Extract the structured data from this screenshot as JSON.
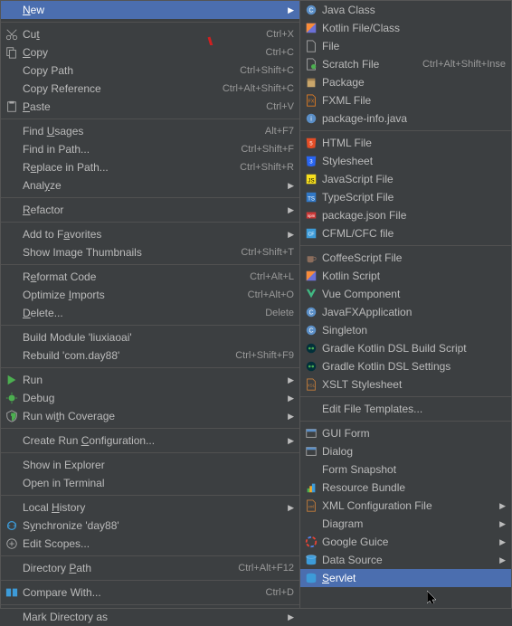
{
  "left": [
    {
      "type": "item",
      "icon": "",
      "label": "New",
      "shortcut": "",
      "arrow": true,
      "selected": true,
      "u": 0
    },
    {
      "type": "sep"
    },
    {
      "type": "item",
      "icon": "cut",
      "label": "Cut",
      "shortcut": "Ctrl+X",
      "u": 2
    },
    {
      "type": "item",
      "icon": "copy",
      "label": "Copy",
      "shortcut": "Ctrl+C",
      "u": 0
    },
    {
      "type": "item",
      "icon": "",
      "label": "Copy Path",
      "shortcut": "Ctrl+Shift+C"
    },
    {
      "type": "item",
      "icon": "",
      "label": "Copy Reference",
      "shortcut": "Ctrl+Alt+Shift+C"
    },
    {
      "type": "item",
      "icon": "paste",
      "label": "Paste",
      "shortcut": "Ctrl+V",
      "u": 0
    },
    {
      "type": "sep"
    },
    {
      "type": "item",
      "icon": "",
      "label": "Find Usages",
      "shortcut": "Alt+F7",
      "u": 5
    },
    {
      "type": "item",
      "icon": "",
      "label": "Find in Path...",
      "shortcut": "Ctrl+Shift+F"
    },
    {
      "type": "item",
      "icon": "",
      "label": "Replace in Path...",
      "shortcut": "Ctrl+Shift+R",
      "u": 1
    },
    {
      "type": "item",
      "icon": "",
      "label": "Analyze",
      "arrow": true,
      "u": 4
    },
    {
      "type": "sep"
    },
    {
      "type": "item",
      "icon": "",
      "label": "Refactor",
      "arrow": true,
      "u": 0
    },
    {
      "type": "sep"
    },
    {
      "type": "item",
      "icon": "",
      "label": "Add to Favorites",
      "arrow": true,
      "u": 8
    },
    {
      "type": "item",
      "icon": "",
      "label": "Show Image Thumbnails",
      "shortcut": "Ctrl+Shift+T"
    },
    {
      "type": "sep"
    },
    {
      "type": "item",
      "icon": "",
      "label": "Reformat Code",
      "shortcut": "Ctrl+Alt+L",
      "u": 1
    },
    {
      "type": "item",
      "icon": "",
      "label": "Optimize Imports",
      "shortcut": "Ctrl+Alt+O",
      "u": 9
    },
    {
      "type": "item",
      "icon": "",
      "label": "Delete...",
      "shortcut": "Delete",
      "u": 0
    },
    {
      "type": "sep"
    },
    {
      "type": "item",
      "icon": "",
      "label": "Build Module 'liuxiaoai'"
    },
    {
      "type": "item",
      "icon": "",
      "label": "Rebuild 'com.day88'",
      "shortcut": "Ctrl+Shift+F9"
    },
    {
      "type": "sep"
    },
    {
      "type": "item",
      "icon": "run",
      "label": "Run",
      "arrow": true
    },
    {
      "type": "item",
      "icon": "debug",
      "label": "Debug",
      "arrow": true
    },
    {
      "type": "item",
      "icon": "coverage",
      "label": "Run with Coverage",
      "arrow": true,
      "u": 6
    },
    {
      "type": "sep"
    },
    {
      "type": "item",
      "icon": "",
      "label": "Create Run Configuration...",
      "arrow": true,
      "u": 11
    },
    {
      "type": "sep"
    },
    {
      "type": "item",
      "icon": "",
      "label": "Show in Explorer"
    },
    {
      "type": "item",
      "icon": "",
      "label": "Open in Terminal"
    },
    {
      "type": "sep"
    },
    {
      "type": "item",
      "icon": "",
      "label": "Local History",
      "arrow": true,
      "u": 6
    },
    {
      "type": "item",
      "icon": "sync",
      "label": "Synchronize 'day88'",
      "u": 1
    },
    {
      "type": "item",
      "icon": "edit",
      "label": "Edit Scopes..."
    },
    {
      "type": "sep"
    },
    {
      "type": "item",
      "icon": "",
      "label": "Directory Path",
      "shortcut": "Ctrl+Alt+F12",
      "u": 10
    },
    {
      "type": "sep"
    },
    {
      "type": "item",
      "icon": "diff",
      "label": "Compare With...",
      "shortcut": "Ctrl+D"
    },
    {
      "type": "sep"
    },
    {
      "type": "item",
      "icon": "",
      "label": "Mark Directory as",
      "arrow": true
    }
  ],
  "right": [
    {
      "type": "item",
      "icon": "java",
      "label": "Java Class"
    },
    {
      "type": "item",
      "icon": "kotlin",
      "label": "Kotlin File/Class"
    },
    {
      "type": "item",
      "icon": "file",
      "label": "File"
    },
    {
      "type": "item",
      "icon": "scratch",
      "label": "Scratch File",
      "shortcut": "Ctrl+Alt+Shift+Inse"
    },
    {
      "type": "item",
      "icon": "package",
      "label": "Package"
    },
    {
      "type": "item",
      "icon": "fxml",
      "label": "FXML File"
    },
    {
      "type": "item",
      "icon": "pkginfo",
      "label": "package-info.java"
    },
    {
      "type": "sep"
    },
    {
      "type": "item",
      "icon": "html",
      "label": "HTML File"
    },
    {
      "type": "item",
      "icon": "css",
      "label": "Stylesheet"
    },
    {
      "type": "item",
      "icon": "js",
      "label": "JavaScript File"
    },
    {
      "type": "item",
      "icon": "ts",
      "label": "TypeScript File"
    },
    {
      "type": "item",
      "icon": "npm",
      "label": "package.json File"
    },
    {
      "type": "item",
      "icon": "cfml",
      "label": "CFML/CFC file"
    },
    {
      "type": "sep"
    },
    {
      "type": "item",
      "icon": "coffee",
      "label": "CoffeeScript File"
    },
    {
      "type": "item",
      "icon": "kotlin2",
      "label": "Kotlin Script"
    },
    {
      "type": "item",
      "icon": "vue",
      "label": "Vue Component"
    },
    {
      "type": "item",
      "icon": "javafx",
      "label": "JavaFXApplication"
    },
    {
      "type": "item",
      "icon": "singleton",
      "label": "Singleton"
    },
    {
      "type": "item",
      "icon": "gradle",
      "label": "Gradle Kotlin DSL Build Script"
    },
    {
      "type": "item",
      "icon": "gradle",
      "label": "Gradle Kotlin DSL Settings"
    },
    {
      "type": "item",
      "icon": "xslt",
      "label": "XSLT Stylesheet"
    },
    {
      "type": "sep"
    },
    {
      "type": "item",
      "icon": "",
      "label": "Edit File Templates..."
    },
    {
      "type": "sep"
    },
    {
      "type": "item",
      "icon": "gui",
      "label": "GUI Form"
    },
    {
      "type": "item",
      "icon": "dialog",
      "label": "Dialog"
    },
    {
      "type": "item",
      "icon": "",
      "label": "Form Snapshot"
    },
    {
      "type": "item",
      "icon": "bundle",
      "label": "Resource Bundle"
    },
    {
      "type": "item",
      "icon": "xml",
      "label": "XML Configuration File",
      "arrow": true
    },
    {
      "type": "item",
      "icon": "",
      "label": "Diagram",
      "arrow": true
    },
    {
      "type": "item",
      "icon": "google",
      "label": "Google Guice",
      "arrow": true
    },
    {
      "type": "item",
      "icon": "db",
      "label": "Data Source",
      "arrow": true
    },
    {
      "type": "item",
      "icon": "servlet",
      "label": "Servlet",
      "selected": true,
      "u": 0
    }
  ]
}
